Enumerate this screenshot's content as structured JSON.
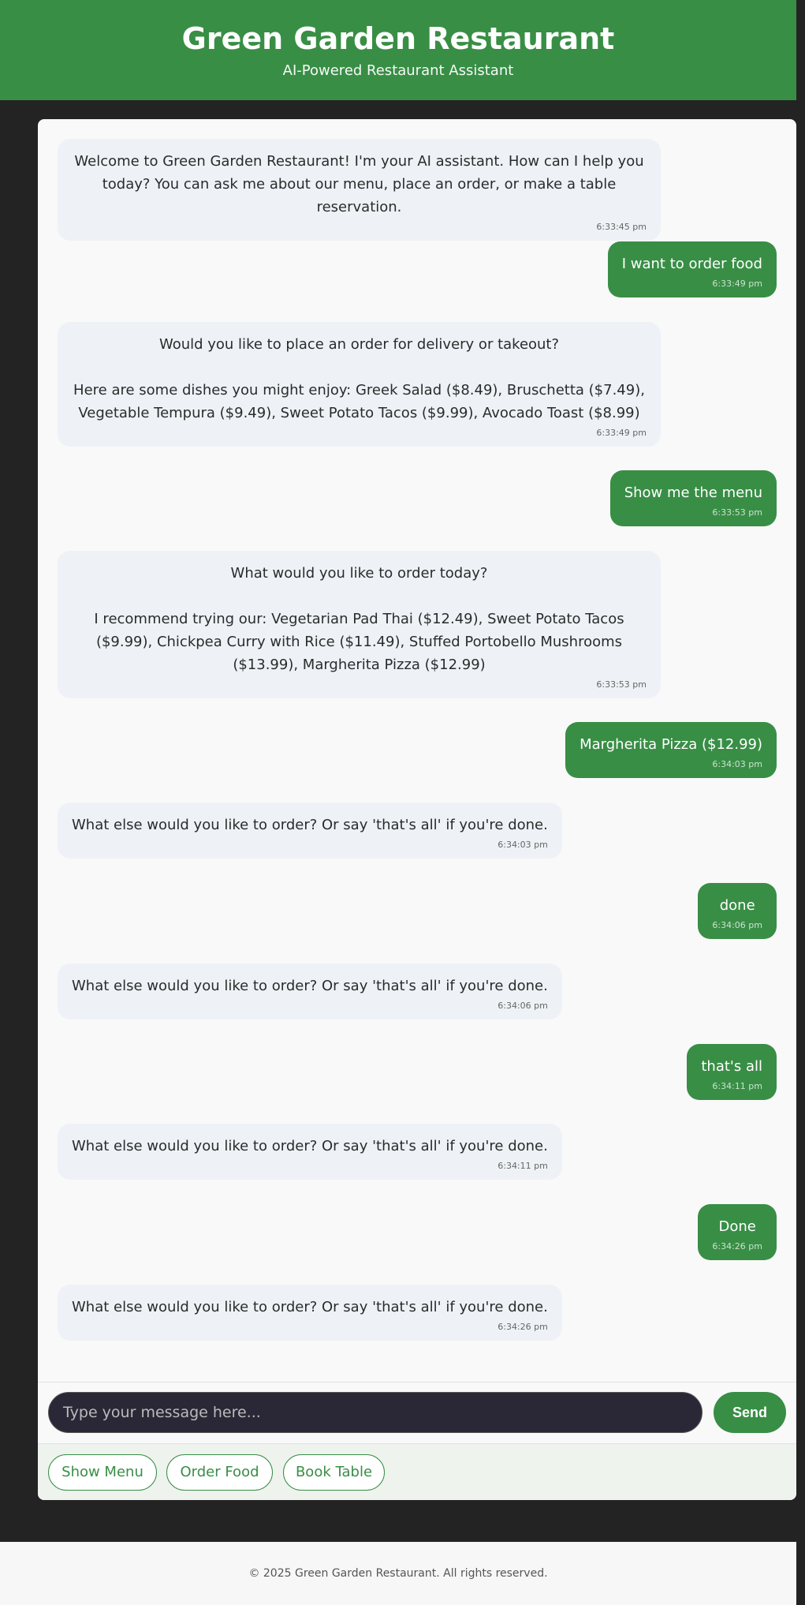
{
  "header": {
    "title": "Green Garden Restaurant",
    "subtitle": "AI-Powered Restaurant Assistant"
  },
  "messages": [
    {
      "role": "bot",
      "text": "Welcome to Green Garden Restaurant! I'm your AI assistant. How can I help you today? You can ask me about our menu, place an order, or make a table reservation.",
      "time": "6:33:45 pm"
    },
    {
      "role": "user",
      "text": "I want to order food",
      "time": "6:33:49 pm"
    },
    {
      "role": "bot",
      "text": "Would you like to place an order for delivery or takeout?\n\nHere are some dishes you might enjoy: Greek Salad ($8.49), Bruschetta ($7.49), Vegetable Tempura ($9.49), Sweet Potato Tacos ($9.99), Avocado Toast ($8.99)",
      "time": "6:33:49 pm"
    },
    {
      "role": "user",
      "text": "Show me the menu",
      "time": "6:33:53 pm"
    },
    {
      "role": "bot",
      "text": "What would you like to order today?\n\nI recommend trying our: Vegetarian Pad Thai ($12.49), Sweet Potato Tacos ($9.99), Chickpea Curry with Rice ($11.49), Stuffed Portobello Mushrooms ($13.99), Margherita Pizza ($12.99)",
      "time": "6:33:53 pm"
    },
    {
      "role": "user",
      "text": "Margherita Pizza ($12.99)",
      "time": "6:34:03 pm"
    },
    {
      "role": "bot",
      "text": "What else would you like to order? Or say 'that's all' if you're done.",
      "time": "6:34:03 pm"
    },
    {
      "role": "user",
      "text": "done",
      "time": "6:34:06 pm"
    },
    {
      "role": "bot",
      "text": "What else would you like to order? Or say 'that's all' if you're done.",
      "time": "6:34:06 pm"
    },
    {
      "role": "user",
      "text": "that's all",
      "time": "6:34:11 pm"
    },
    {
      "role": "bot",
      "text": "What else would you like to order? Or say 'that's all' if you're done.",
      "time": "6:34:11 pm"
    },
    {
      "role": "user",
      "text": "Done",
      "time": "6:34:26 pm"
    },
    {
      "role": "bot",
      "text": "What else would you like to order? Or say 'that's all' if you're done.",
      "time": "6:34:26 pm"
    }
  ],
  "input": {
    "placeholder": "Type your message here...",
    "send_label": "Send"
  },
  "quick_actions": {
    "show_menu": "Show Menu",
    "order_food": "Order Food",
    "book_table": "Book Table"
  },
  "footer": {
    "text": "© 2025 Green Garden Restaurant. All rights reserved."
  }
}
